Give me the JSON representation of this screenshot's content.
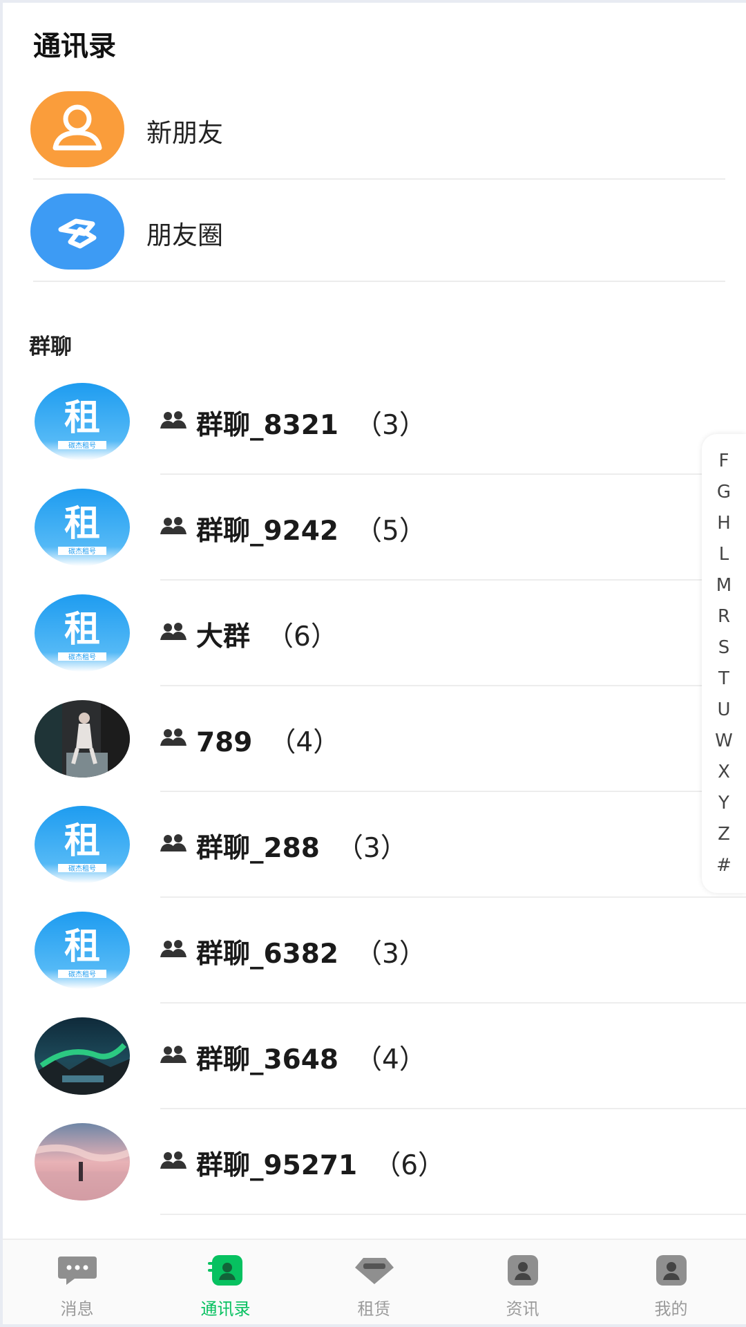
{
  "header": {
    "title": "通讯录"
  },
  "top_items": [
    {
      "label": "新朋友",
      "icon": "user-icon",
      "color": "#fa9d3b"
    },
    {
      "label": "朋友圈",
      "icon": "moments-icon",
      "color": "#3d9bf4"
    }
  ],
  "section": {
    "title": "群聊"
  },
  "groups": [
    {
      "name": "群聊_8321",
      "count": "（3）",
      "avatar": "zu-logo"
    },
    {
      "name": "群聊_9242",
      "count": "（5）",
      "avatar": "zu-logo"
    },
    {
      "name": "大群",
      "count": "（6）",
      "avatar": "zu-logo"
    },
    {
      "name": "789",
      "count": "（4）",
      "avatar": "photo-room"
    },
    {
      "name": "群聊_288",
      "count": "（3）",
      "avatar": "zu-logo"
    },
    {
      "name": "群聊_6382",
      "count": "（3）",
      "avatar": "zu-logo"
    },
    {
      "name": "群聊_3648",
      "count": "（4）",
      "avatar": "photo-aurora"
    },
    {
      "name": "群聊_95271",
      "count": "（6）",
      "avatar": "photo-sunset"
    }
  ],
  "index_letters": [
    "F",
    "G",
    "H",
    "L",
    "M",
    "R",
    "S",
    "T",
    "U",
    "W",
    "X",
    "Y",
    "Z",
    "#"
  ],
  "tabbar": {
    "active_color": "#07c160",
    "tabs": [
      {
        "label": "消息",
        "icon": "chat-icon"
      },
      {
        "label": "通讯录",
        "icon": "contacts-icon",
        "active": true
      },
      {
        "label": "租赁",
        "icon": "diamond-icon"
      },
      {
        "label": "资讯",
        "icon": "news-icon"
      },
      {
        "label": "我的",
        "icon": "profile-icon"
      }
    ]
  }
}
